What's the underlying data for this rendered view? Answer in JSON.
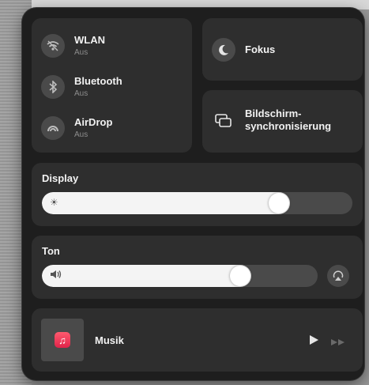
{
  "connectivity": {
    "items": [
      {
        "label": "WLAN",
        "status": "Aus",
        "icon": "wifi-icon"
      },
      {
        "label": "Bluetooth",
        "status": "Aus",
        "icon": "bluetooth-icon"
      },
      {
        "label": "AirDrop",
        "status": "Aus",
        "icon": "airdrop-icon"
      }
    ]
  },
  "focus": {
    "label": "Fokus",
    "icon": "moon-icon"
  },
  "screen_mirroring": {
    "label_line1": "Bildschirm-",
    "label_line2": "synchronisierung",
    "icon": "screen-mirroring-icon"
  },
  "display": {
    "title": "Display",
    "level": 0.8,
    "icon": "sun-icon"
  },
  "sound": {
    "title": "Ton",
    "level": 0.76,
    "icon": "speaker-icon",
    "output_icon": "airplay-audio-icon"
  },
  "music": {
    "label": "Musik",
    "icon": "music-app-icon",
    "controls": [
      "play-icon",
      "forward-icon"
    ]
  },
  "colors": {
    "panel": "#1e1e1e",
    "tile": "#2e2e2e",
    "accent_music": "#f0344f"
  }
}
